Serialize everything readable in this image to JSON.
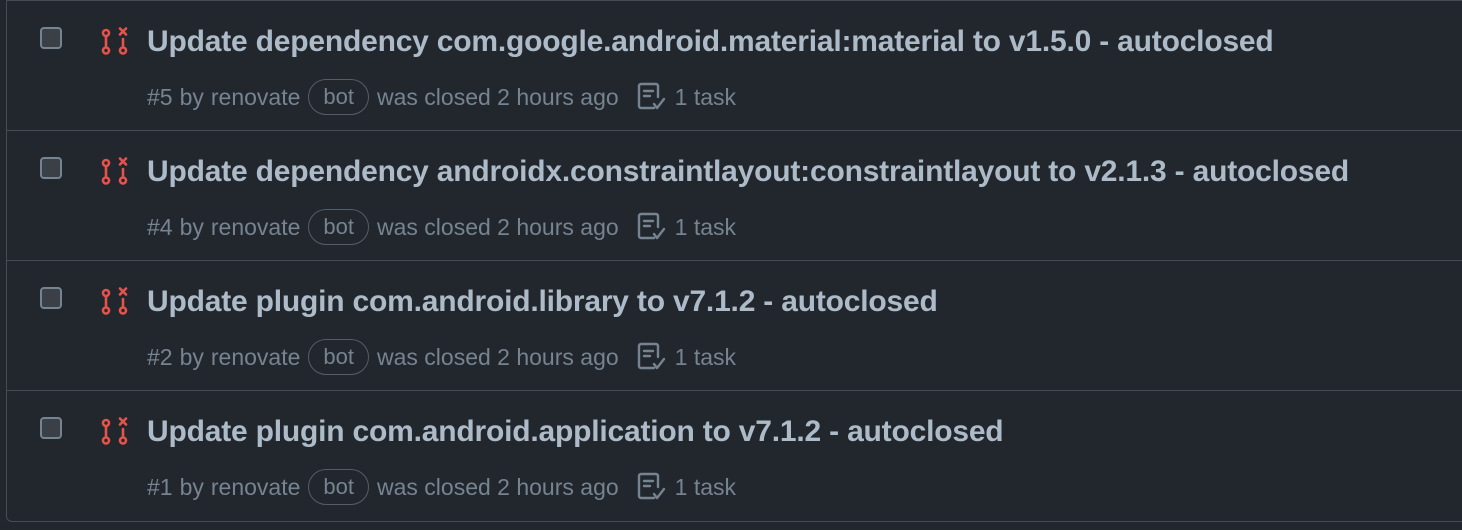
{
  "colors": {
    "background": "#22272e",
    "border": "#444c56",
    "title": "#adbac7",
    "muted": "#768390",
    "closed_pr_icon": "#e5534b"
  },
  "icons": {
    "status": "git-pull-request-closed-icon",
    "task": "checklist-icon"
  },
  "pull_requests": [
    {
      "title": "Update dependency com.google.android.material:material to v1.5.0 - autoclosed",
      "number": "#5",
      "by": "by",
      "author": "renovate",
      "badge": "bot",
      "status_text": "was closed 2 hours ago",
      "tasks": "1 task"
    },
    {
      "title": "Update dependency androidx.constraintlayout:constraintlayout to v2.1.3 - autoclosed",
      "number": "#4",
      "by": "by",
      "author": "renovate",
      "badge": "bot",
      "status_text": "was closed 2 hours ago",
      "tasks": "1 task"
    },
    {
      "title": "Update plugin com.android.library to v7.1.2 - autoclosed",
      "number": "#2",
      "by": "by",
      "author": "renovate",
      "badge": "bot",
      "status_text": "was closed 2 hours ago",
      "tasks": "1 task"
    },
    {
      "title": "Update plugin com.android.application to v7.1.2 - autoclosed",
      "number": "#1",
      "by": "by",
      "author": "renovate",
      "badge": "bot",
      "status_text": "was closed 2 hours ago",
      "tasks": "1 task"
    }
  ]
}
